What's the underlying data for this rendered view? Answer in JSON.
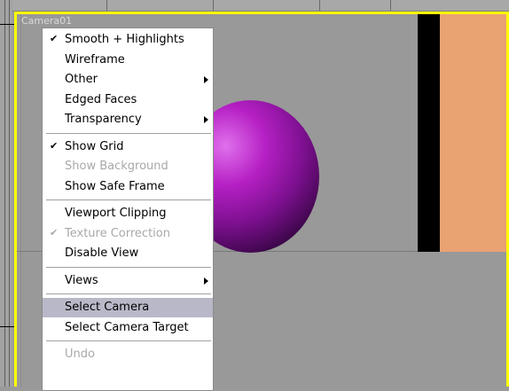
{
  "viewport": {
    "label": "Camera01",
    "border_color": "#ffff00",
    "sphere_color": "#b520c4",
    "panel_color": "#e9a272"
  },
  "menu": {
    "groups": [
      [
        {
          "label": "Smooth + Highlights",
          "checked": true,
          "submenu": false,
          "disabled": false
        },
        {
          "label": "Wireframe",
          "checked": false,
          "submenu": false,
          "disabled": false
        },
        {
          "label": "Other",
          "checked": false,
          "submenu": true,
          "disabled": false
        },
        {
          "label": "Edged Faces",
          "checked": false,
          "submenu": false,
          "disabled": false
        },
        {
          "label": "Transparency",
          "checked": false,
          "submenu": true,
          "disabled": false
        }
      ],
      [
        {
          "label": "Show Grid",
          "checked": true,
          "submenu": false,
          "disabled": false
        },
        {
          "label": "Show Background",
          "checked": false,
          "submenu": false,
          "disabled": true
        },
        {
          "label": "Show Safe Frame",
          "checked": false,
          "submenu": false,
          "disabled": false
        }
      ],
      [
        {
          "label": "Viewport Clipping",
          "checked": false,
          "submenu": false,
          "disabled": false
        },
        {
          "label": "Texture Correction",
          "checked": true,
          "submenu": false,
          "disabled": true
        },
        {
          "label": "Disable View",
          "checked": false,
          "submenu": false,
          "disabled": false
        }
      ],
      [
        {
          "label": "Views",
          "checked": false,
          "submenu": true,
          "disabled": false
        }
      ],
      [
        {
          "label": "Select Camera",
          "checked": false,
          "submenu": false,
          "disabled": false,
          "selected": true
        },
        {
          "label": "Select Camera Target",
          "checked": false,
          "submenu": false,
          "disabled": false
        }
      ],
      [
        {
          "label": "Undo",
          "checked": false,
          "submenu": false,
          "disabled": true
        }
      ]
    ],
    "check_glyph": "✔",
    "selected_color": "#b8b8c8"
  }
}
